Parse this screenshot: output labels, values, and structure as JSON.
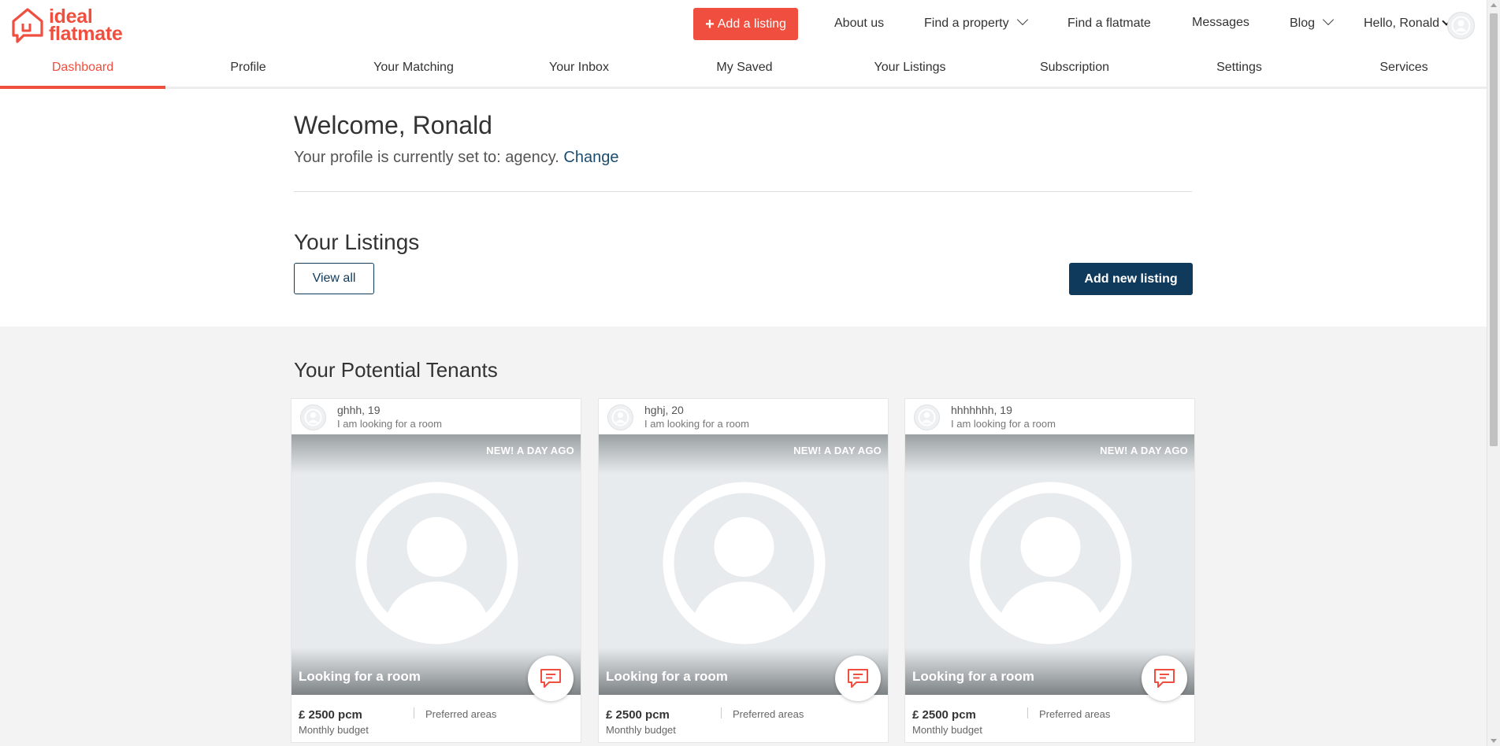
{
  "header": {
    "logo_line1": "ideal",
    "logo_line2": "flatmate",
    "add_listing_label": "Add a listing",
    "nav": {
      "about": "About us",
      "find_property": "Find a property",
      "find_flatmate": "Find a flatmate",
      "messages": "Messages",
      "blog": "Blog"
    },
    "user_greeting": "Hello, Ronald"
  },
  "tabs": [
    {
      "label": "Dashboard",
      "active": true
    },
    {
      "label": "Profile",
      "active": false
    },
    {
      "label": "Your Matching",
      "active": false
    },
    {
      "label": "Your Inbox",
      "active": false
    },
    {
      "label": "My Saved",
      "active": false
    },
    {
      "label": "Your Listings",
      "active": false
    },
    {
      "label": "Subscription",
      "active": false
    },
    {
      "label": "Settings",
      "active": false
    },
    {
      "label": "Services",
      "active": false
    }
  ],
  "welcome": {
    "title": "Welcome, Ronald",
    "profile_text": "Your profile is currently set to: agency.",
    "change_link": "Change"
  },
  "listings": {
    "title": "Your Listings",
    "view_all_label": "View all",
    "add_new_label": "Add new listing"
  },
  "tenants": {
    "title": "Your Potential Tenants",
    "cards": [
      {
        "name": "ghhh, 19",
        "subtitle": "I am looking for a room",
        "badge": "NEW! A DAY AGO",
        "looking": "Looking for a room",
        "price": "£ 2500 pcm",
        "budget_label": "Monthly budget",
        "areas_label": "Preferred areas"
      },
      {
        "name": "hghj, 20",
        "subtitle": "I am looking for a room",
        "badge": "NEW! A DAY AGO",
        "looking": "Looking for a room",
        "price": "£ 2500 pcm",
        "budget_label": "Monthly budget",
        "areas_label": "Preferred areas"
      },
      {
        "name": "hhhhhhh, 19",
        "subtitle": "I am looking for a room",
        "badge": "NEW! A DAY AGO",
        "looking": "Looking for a room",
        "price": "£ 2500 pcm",
        "budget_label": "Monthly budget",
        "areas_label": "Preferred areas"
      }
    ]
  },
  "colors": {
    "brand_red": "#f04e3e",
    "navy": "#0f3a5c",
    "section_bg": "#f3f3f3"
  },
  "icons": {
    "logo": "house-speech-icon",
    "plus": "plus-icon",
    "chevron": "chevron-down-icon",
    "avatar": "user-avatar-icon",
    "message": "chat-bubble-icon"
  }
}
